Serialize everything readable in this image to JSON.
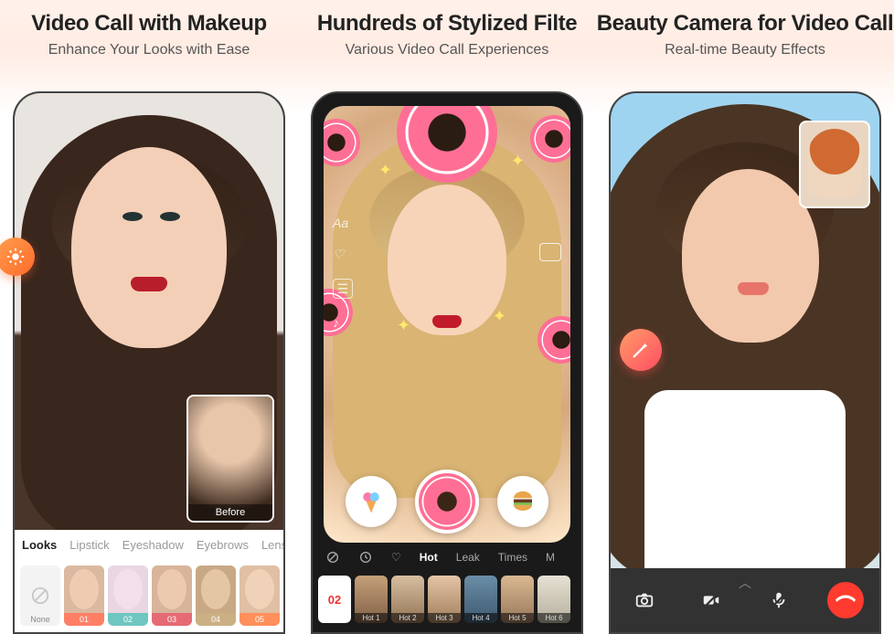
{
  "panels": [
    {
      "title": "Video Call with Makeup",
      "subtitle": "Enhance Your Looks with Ease",
      "before_label": "Before",
      "tabs": [
        "Looks",
        "Lipstick",
        "Eyeshadow",
        "Eyebrows",
        "Lens"
      ],
      "active_tab": "Looks",
      "thumbs": [
        {
          "label": "None",
          "color": "#bdbdbd"
        },
        {
          "label": "01",
          "color": "#ff7f66"
        },
        {
          "label": "02",
          "color": "#6fc6c0"
        },
        {
          "label": "03",
          "color": "#e66a74"
        },
        {
          "label": "04",
          "color": "#cbb083"
        },
        {
          "label": "05",
          "color": "#ff8f5b"
        }
      ]
    },
    {
      "title": "Hundreds of Stylized Filte",
      "subtitle": "Various Video Call Experiences",
      "text_tool": "Aa",
      "categories": [
        "Hot",
        "Leak",
        "Times",
        "M"
      ],
      "active_category": "Hot",
      "badge": "02",
      "hot_thumbs": [
        "Hot 1",
        "Hot 2",
        "Hot 3",
        "Hot 4",
        "Hot 5",
        "Hot 6"
      ]
    },
    {
      "title": "Beauty Camera for Video Call",
      "subtitle": "Real-time Beauty Effects"
    }
  ]
}
